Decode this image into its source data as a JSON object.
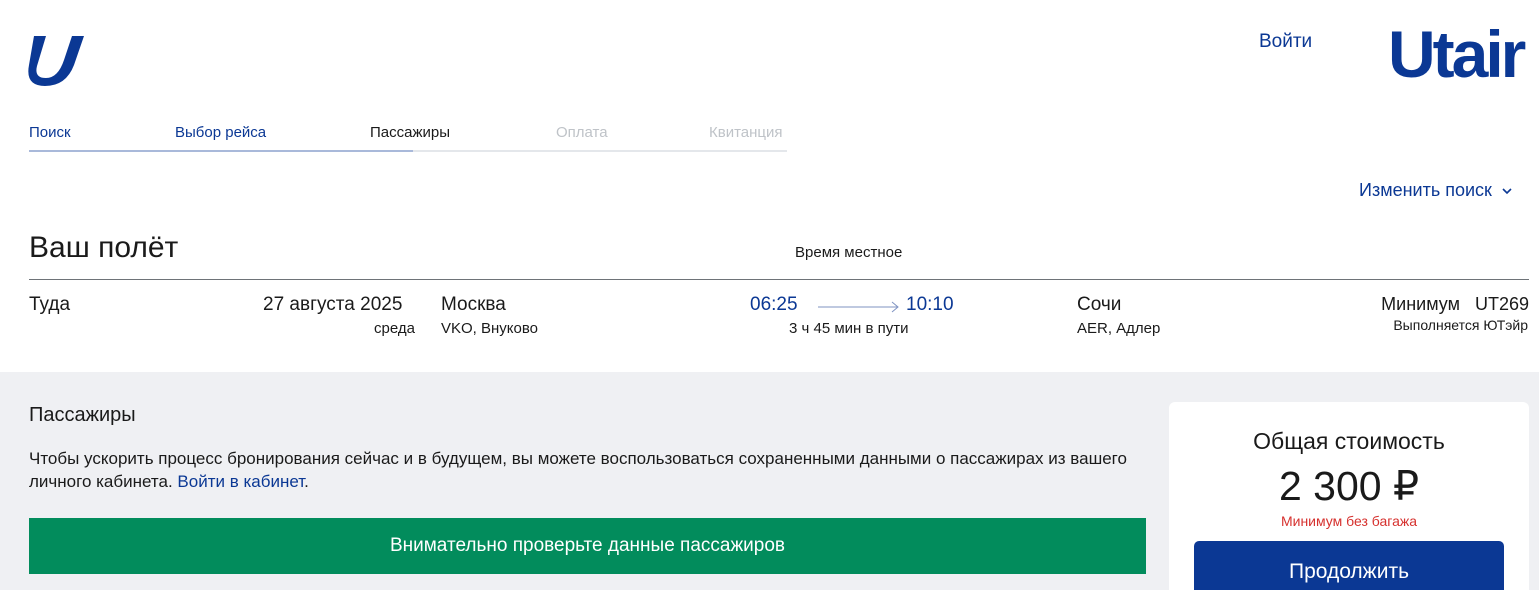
{
  "header": {
    "login_label": "Войти",
    "brand": "Utair",
    "brand_color": "#0b3894",
    "logo_icon": "utair-u-logo-icon"
  },
  "steps": [
    {
      "label": "Поиск",
      "state": "done"
    },
    {
      "label": "Выбор рейса",
      "state": "done"
    },
    {
      "label": "Пассажиры",
      "state": "current"
    },
    {
      "label": "Оплата",
      "state": "future"
    },
    {
      "label": "Квитанция",
      "state": "future"
    }
  ],
  "change_search": {
    "label": "Изменить поиск",
    "icon": "chevron-down-icon"
  },
  "flight": {
    "title": "Ваш полёт",
    "local_time_note": "Время местное",
    "direction": "Туда",
    "date": "27 августа 2025",
    "weekday": "среда",
    "departure": {
      "city": "Москва",
      "airport": "VKO, Внуково",
      "time": "06:25"
    },
    "arrival": {
      "city": "Сочи",
      "airport": "AER, Адлер",
      "time": "10:10"
    },
    "duration": "3 ч 45 мин в пути",
    "fare": "Минимум",
    "flight_number": "UT269",
    "operator": "Выполняется ЮТэйр"
  },
  "passengers": {
    "heading": "Пассажиры",
    "description": "Чтобы ускорить процесс бронирования сейчас и в будущем, вы можете воспользоваться сохраненными данными о пассажирах из вашего личного кабинета.",
    "login_link": "Войти в кабинет",
    "period": ".",
    "check_notice": "Внимательно проверьте данные пассажиров",
    "notice_color": "#028c5c"
  },
  "price": {
    "label": "Общая стоимость",
    "value": "2 300 ₽",
    "note": "Минимум без багажа",
    "note_color": "#d6312e",
    "continue_label": "Продолжить"
  }
}
